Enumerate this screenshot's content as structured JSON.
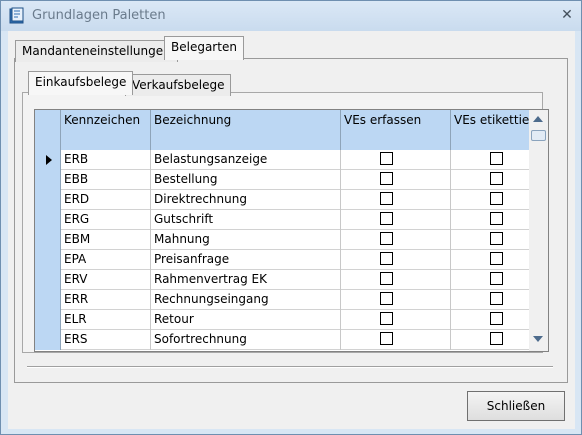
{
  "window": {
    "title": "Grundlagen Paletten",
    "close_glyph": "✕",
    "icon": "app-logo-icon"
  },
  "tabs": [
    {
      "label": "Mandanteneinstellungen",
      "active": false
    },
    {
      "label": "Belegarten",
      "active": true
    }
  ],
  "subtabs": [
    {
      "label": "Einkaufsbelege",
      "active": true
    },
    {
      "label": "Verkaufsbelege",
      "active": false
    }
  ],
  "grid": {
    "columns": [
      "Kennzeichen",
      "Bezeichnung",
      "VEs erfassen",
      "VEs etikettieren"
    ],
    "rows": [
      {
        "code": "ERB",
        "name": "Belastungsanzeige",
        "ves_erfassen": false,
        "ves_etikettieren": false,
        "current": true
      },
      {
        "code": "EBB",
        "name": "Bestellung",
        "ves_erfassen": false,
        "ves_etikettieren": false,
        "current": false
      },
      {
        "code": "ERD",
        "name": "Direktrechnung",
        "ves_erfassen": false,
        "ves_etikettieren": false,
        "current": false
      },
      {
        "code": "ERG",
        "name": "Gutschrift",
        "ves_erfassen": false,
        "ves_etikettieren": false,
        "current": false
      },
      {
        "code": "EBM",
        "name": "Mahnung",
        "ves_erfassen": false,
        "ves_etikettieren": false,
        "current": false
      },
      {
        "code": "EPA",
        "name": "Preisanfrage",
        "ves_erfassen": false,
        "ves_etikettieren": false,
        "current": false
      },
      {
        "code": "ERV",
        "name": "Rahmenvertrag EK",
        "ves_erfassen": false,
        "ves_etikettieren": false,
        "current": false
      },
      {
        "code": "ERR",
        "name": "Rechnungseingang",
        "ves_erfassen": false,
        "ves_etikettieren": false,
        "current": false
      },
      {
        "code": "ELR",
        "name": "Retour",
        "ves_erfassen": false,
        "ves_etikettieren": false,
        "current": false
      },
      {
        "code": "ERS",
        "name": "Sofortrechnung",
        "ves_erfassen": false,
        "ves_etikettieren": false,
        "current": false
      }
    ]
  },
  "buttons": {
    "close_label": "Schließen"
  },
  "colors": {
    "header_bg": "#bcd7f3",
    "window_bg": "#d8e6f4"
  }
}
